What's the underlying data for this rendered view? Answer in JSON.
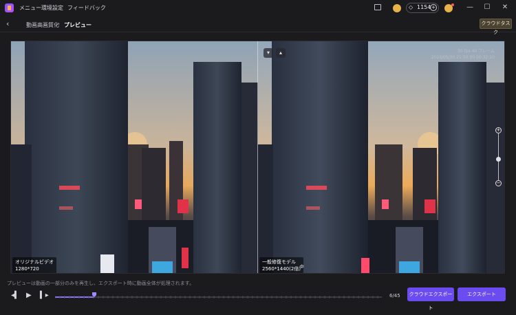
{
  "titlebar": {
    "menu_items": [
      "メニュー",
      "環境設定",
      "フィードバック"
    ],
    "credits": "1154"
  },
  "header": {
    "breadcrumb": [
      "動画高画質化",
      "プレビュー"
    ],
    "cloud_task_label": "クラウドタスク"
  },
  "preview": {
    "left": {
      "title": "オリジナルビデオ",
      "resolution": "1280*720"
    },
    "right": {
      "title": "一般修復モデル",
      "resolution": "2560*1440(2倍)"
    },
    "watermark_lines": [
      "30 fps 40 フレーム",
      "2023/05/30 21:50:00 00:32:10"
    ]
  },
  "footer": {
    "notice": "プレビューは動画の一部分のみを再生し、エクスポート時に動画全体が処理されます。",
    "frame_counter": "6/45",
    "playback_progress": 0.12,
    "cloud_export_label": "クラウドエクスポート",
    "export_label": "エクスポート"
  },
  "colors": {
    "accent": "#6a4cf0",
    "background": "#1b1b1d"
  }
}
